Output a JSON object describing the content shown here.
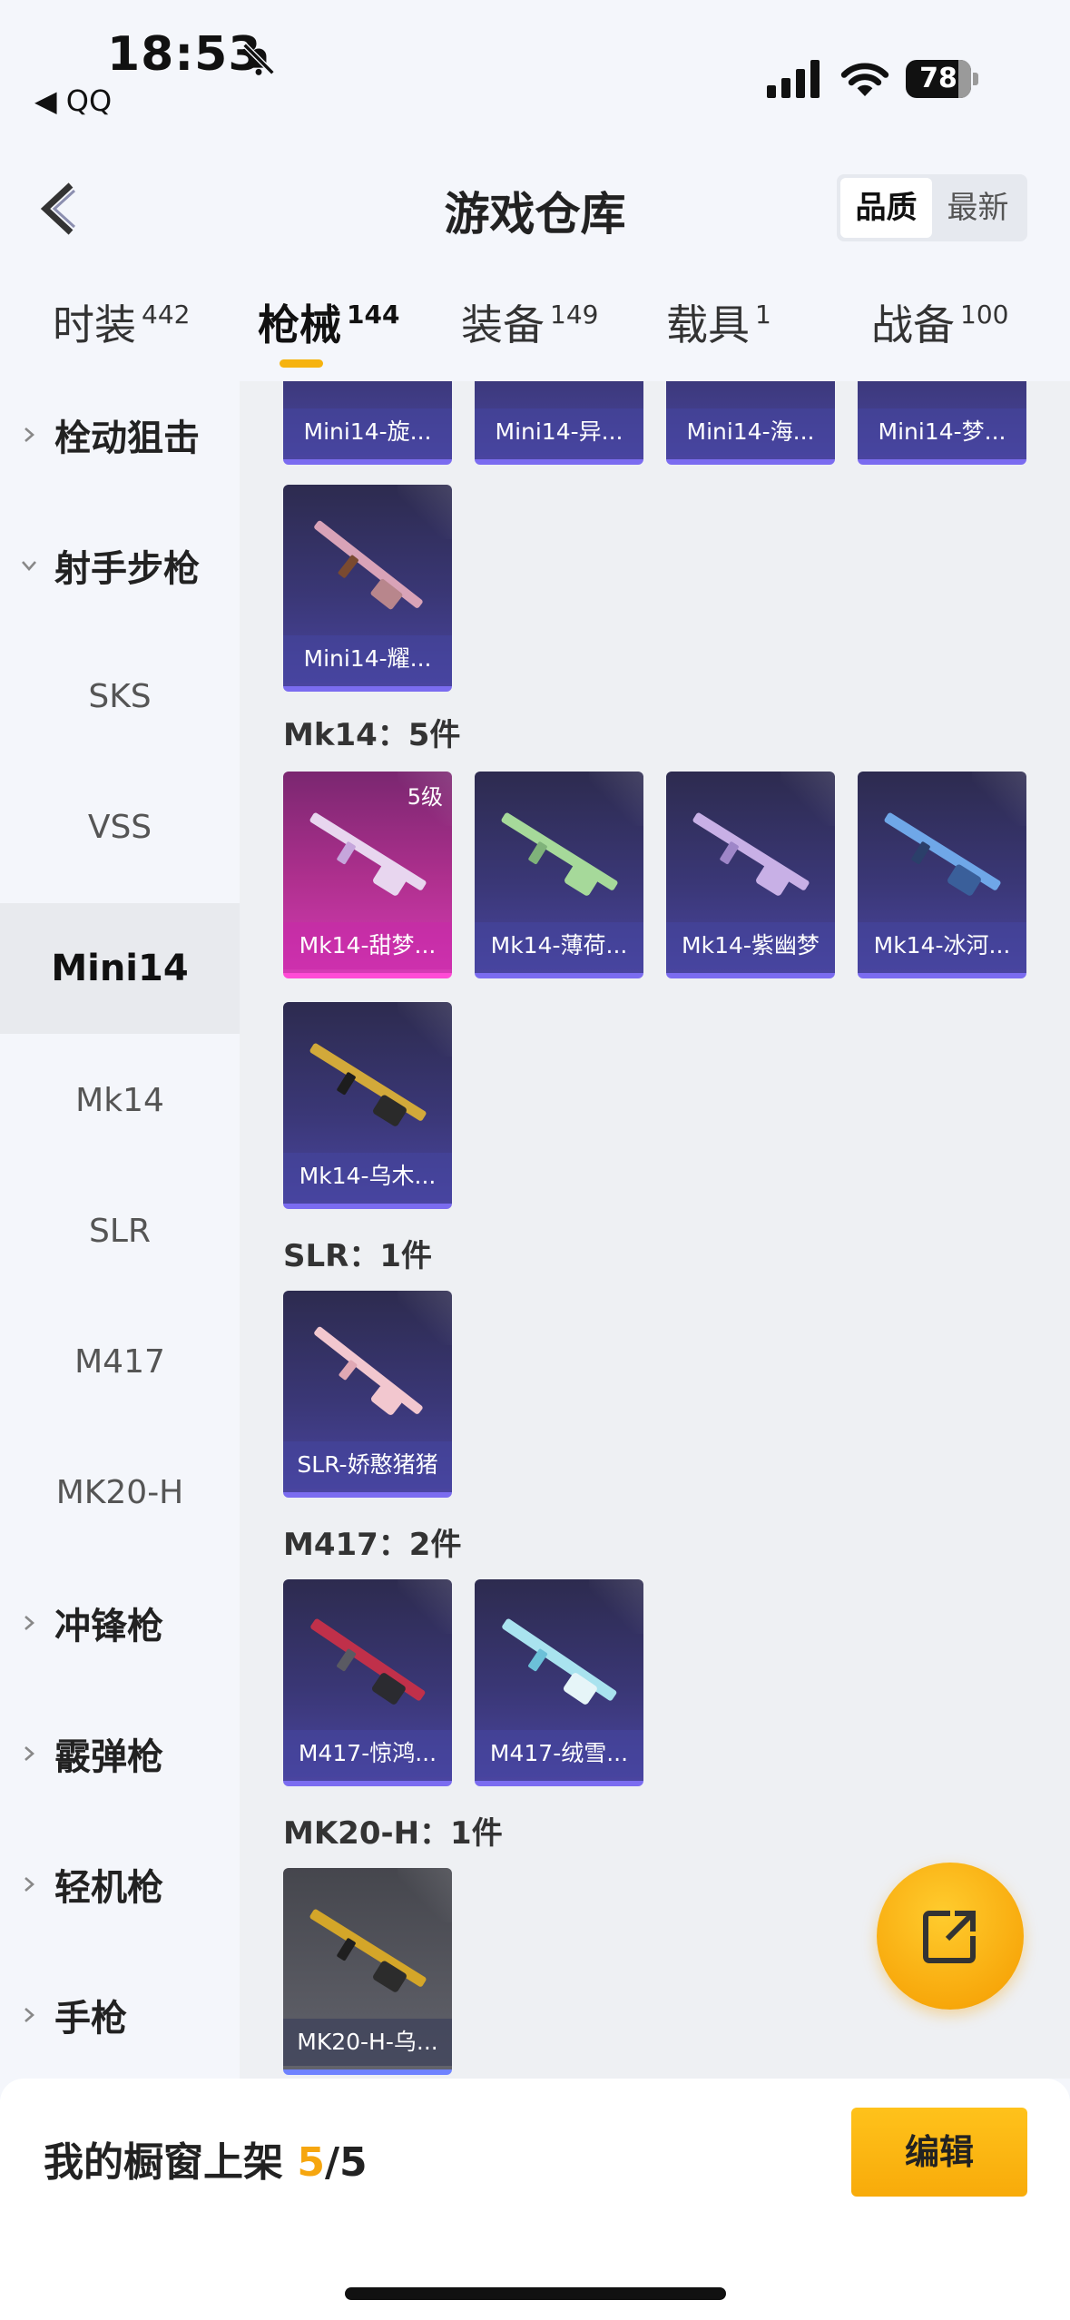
{
  "status_bar": {
    "time": "18:53",
    "back_app": "◀ QQ",
    "battery": "78"
  },
  "header": {
    "title": "游戏仓库",
    "sort_options": [
      "品质",
      "最新"
    ],
    "sort_active": "品质"
  },
  "tabs": [
    {
      "label": "时装",
      "count": "442"
    },
    {
      "label": "枪械",
      "count": "144",
      "active": true
    },
    {
      "label": "装备",
      "count": "149"
    },
    {
      "label": "载具",
      "count": "1"
    },
    {
      "label": "战备",
      "count": "100"
    }
  ],
  "sidebar": {
    "items": [
      {
        "label": "栓动狙击",
        "type": "category",
        "expanded": false
      },
      {
        "label": "射手步枪",
        "type": "category",
        "expanded": true
      },
      {
        "label": "SKS",
        "type": "sub"
      },
      {
        "label": "VSS",
        "type": "sub"
      },
      {
        "label": "Mini14",
        "type": "sub",
        "active": true
      },
      {
        "label": "Mk14",
        "type": "sub"
      },
      {
        "label": "SLR",
        "type": "sub"
      },
      {
        "label": "M417",
        "type": "sub"
      },
      {
        "label": "MK20-H",
        "type": "sub"
      },
      {
        "label": "冲锋枪",
        "type": "category",
        "expanded": false
      },
      {
        "label": "霰弹枪",
        "type": "category",
        "expanded": false
      },
      {
        "label": "轻机枪",
        "type": "category",
        "expanded": false
      },
      {
        "label": "手枪",
        "type": "category",
        "expanded": false
      }
    ]
  },
  "content": {
    "mini14_partial": [
      "Mini14-旋...",
      "Mini14-异...",
      "Mini14-海...",
      "Mini14-梦..."
    ],
    "mini14_more": [
      "Mini14-耀..."
    ],
    "groups": [
      {
        "label": "Mk14：5件",
        "items": [
          {
            "name": "Mk14-甜梦...",
            "level": "5级",
            "style": "pink",
            "gun_color": "#e8d6ef"
          },
          {
            "name": "Mk14-薄荷...",
            "style": "purple",
            "gun_color": "#a6d99a"
          },
          {
            "name": "Mk14-紫幽梦",
            "style": "purple",
            "gun_color": "#c8b0e6"
          },
          {
            "name": "Mk14-冰河...",
            "style": "purple",
            "gun_color": "#6fa7e8"
          },
          {
            "name": "Mk14-乌木...",
            "style": "purple",
            "gun_color": "#d2a93a"
          }
        ]
      },
      {
        "label": "SLR：1件",
        "items": [
          {
            "name": "SLR-娇憨猪猪",
            "style": "purple",
            "gun_color": "#f2c7cf"
          }
        ]
      },
      {
        "label": "M417：2件",
        "items": [
          {
            "name": "M417-惊鸿...",
            "style": "purple",
            "gun_color": "#c0304a"
          },
          {
            "name": "M417-绒雪...",
            "style": "purple",
            "gun_color": "#a9e3ef"
          }
        ]
      },
      {
        "label": "MK20-H：1件",
        "items": [
          {
            "name": "MK20-H-乌...",
            "style": "gray",
            "gun_color": "#d4a629"
          }
        ]
      }
    ]
  },
  "bottom_bar": {
    "shelf_label": "我的橱窗上架 ",
    "shelf_count": "5",
    "shelf_total": "/5",
    "edit_label": "编辑"
  },
  "colors": {
    "accent": "#f6b30e",
    "card_purple": "#3a3776",
    "card_pink": "#b0308f"
  }
}
